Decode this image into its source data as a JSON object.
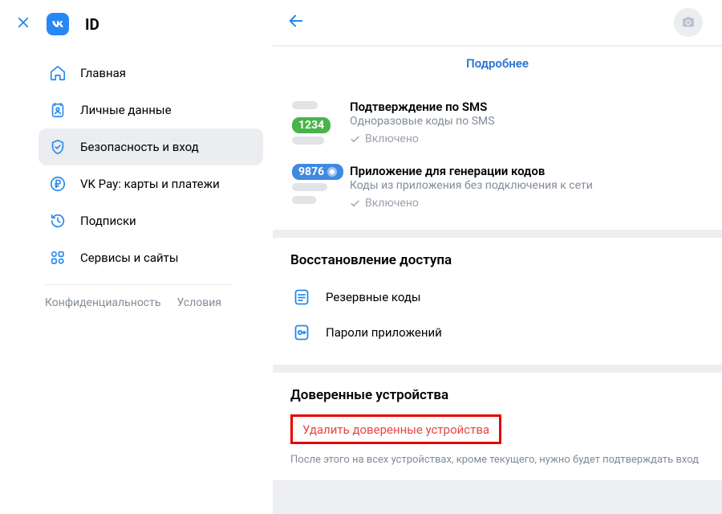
{
  "brand": {
    "id_text": "ID"
  },
  "sidebar": {
    "items": [
      {
        "label": "Главная"
      },
      {
        "label": "Личные данные"
      },
      {
        "label": "Безопасность и вход"
      },
      {
        "label": "VK Pay: карты и платежи"
      },
      {
        "label": "Подписки"
      },
      {
        "label": "Сервисы и сайты"
      }
    ],
    "footer": {
      "privacy": "Конфиденциальность",
      "terms": "Условия"
    }
  },
  "more_link": "Подробнее",
  "methods": {
    "sms": {
      "title": "Подтверждение по SMS",
      "subtitle": "Одноразовые коды по SMS",
      "status": "Включено",
      "badge": "1234"
    },
    "app": {
      "title": "Приложение для генерации кодов",
      "subtitle": "Коды из приложения без подключения к сети",
      "status": "Включено",
      "badge": "9876"
    }
  },
  "recovery": {
    "title": "Восстановление доступа",
    "backup_codes": "Резервные коды",
    "app_passwords": "Пароли приложений"
  },
  "trusted": {
    "title": "Доверенные устройства",
    "delete_link": "Удалить доверенные устройства",
    "note": "После этого на всех устройствах, кроме текущего, нужно будет подтверждать вход"
  }
}
